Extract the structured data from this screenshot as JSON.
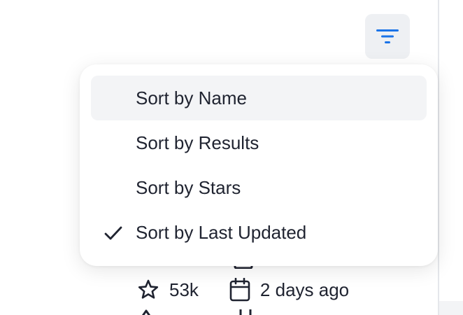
{
  "sort_menu": {
    "items": [
      {
        "label": "Sort by Name",
        "selected": false,
        "hovered": true
      },
      {
        "label": "Sort by Results",
        "selected": false,
        "hovered": false
      },
      {
        "label": "Sort by Stars",
        "selected": false,
        "hovered": false
      },
      {
        "label": "Sort by Last Updated",
        "selected": true,
        "hovered": false
      }
    ]
  },
  "filter_button": {
    "icon": "filter-icon",
    "color": "#1a73e8"
  },
  "card": {
    "stars": "53k",
    "updated": "2 days ago",
    "star_icon": "star-icon",
    "calendar_icon": "calendar-icon"
  },
  "colors": {
    "text": "#1f2330",
    "accent": "#1a73e8",
    "hover_bg": "#f3f4f6",
    "button_bg": "#eef0f3"
  }
}
